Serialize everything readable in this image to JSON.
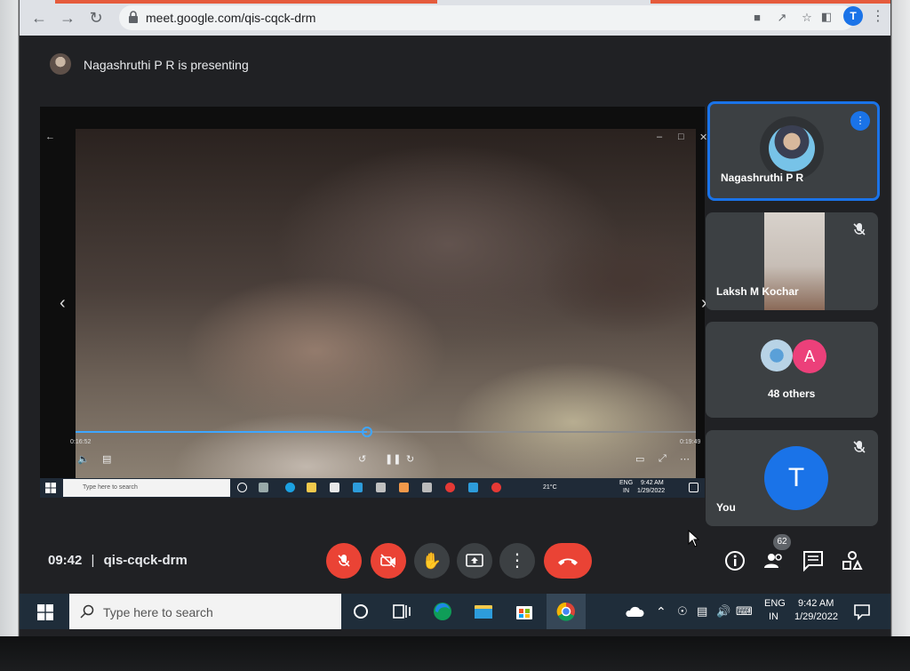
{
  "browser": {
    "url": "meet.google.com/qis-cqck-drm",
    "profile_initial": "T"
  },
  "meet": {
    "presenting_text": "Nagashruthi P R is presenting",
    "time": "09:42",
    "separator": "|",
    "meeting_code": "qis-cqck-drm",
    "participant_count": "62"
  },
  "participants": [
    {
      "name": "Nagashruthi P R"
    },
    {
      "name": "Laksh M Kochar"
    },
    {
      "name": "48 others",
      "avatar_initial": "A"
    },
    {
      "name": "You",
      "avatar_initial": "T"
    }
  ],
  "shared_screen": {
    "elapsed": "0:16:52",
    "duration": "0:19:49",
    "progress_fraction": 0.47,
    "taskbar_search_placeholder": "Type here to search",
    "weather": "21°C",
    "lang_top": "ENG",
    "lang_bottom": "IN",
    "clock_time": "9:42 AM",
    "clock_date": "1/29/2022"
  },
  "taskbar": {
    "search_placeholder": "Type here to search",
    "lang_top": "ENG",
    "lang_bottom": "IN",
    "clock_time": "9:42 AM",
    "clock_date": "1/29/2022"
  },
  "colors": {
    "accent": "#1a73e8",
    "danger": "#ea4335",
    "tile": "#3c4043"
  }
}
